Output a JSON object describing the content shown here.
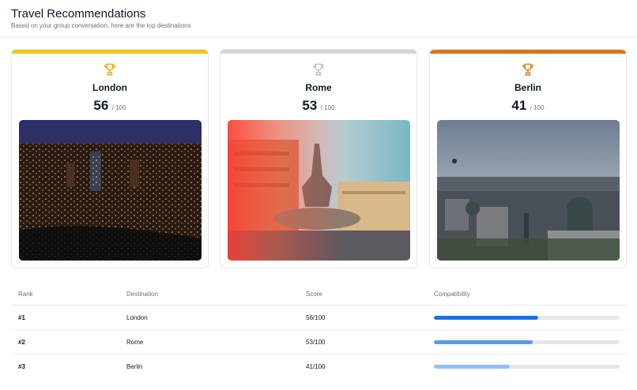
{
  "header": {
    "title": "Travel Recommendations",
    "subtitle": "Based on your group conversation, here are the top destinations"
  },
  "cards": [
    {
      "city": "London",
      "score": "56",
      "outof": "/ 100",
      "accent": "#f0c419",
      "trophy_color": "#e5a800",
      "icon": "trophy-icon"
    },
    {
      "city": "Rome",
      "score": "53",
      "outof": "/ 100",
      "accent": "#d1d5db",
      "trophy_color": "#b9bec7",
      "icon": "trophy-icon"
    },
    {
      "city": "Berlin",
      "score": "41",
      "outof": "/ 100",
      "accent": "#d9761a",
      "trophy_color": "#d9761a",
      "icon": "trophy-icon"
    }
  ],
  "table": {
    "headers": [
      "Rank",
      "Destination",
      "Score",
      "Compatibility"
    ],
    "rows": [
      {
        "rank": "#1",
        "destination": "London",
        "score": "56/100",
        "compatibility": 0.56,
        "bar_color": "#1a73e8"
      },
      {
        "rank": "#2",
        "destination": "Rome",
        "score": "53/100",
        "compatibility": 0.53,
        "bar_color": "#5b9be6"
      },
      {
        "rank": "#3",
        "destination": "Berlin",
        "score": "41/100",
        "compatibility": 0.41,
        "bar_color": "#93c0f0"
      }
    ]
  }
}
